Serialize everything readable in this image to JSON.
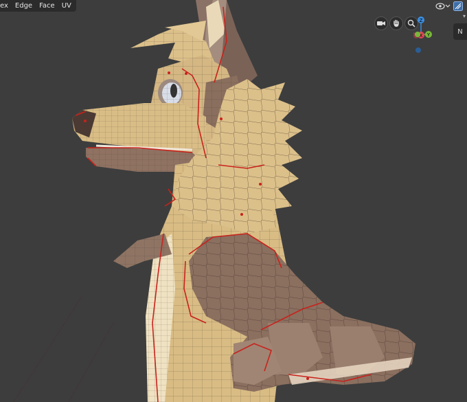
{
  "menu": {
    "items": [
      "ex",
      "Edge",
      "Face",
      "UV"
    ]
  },
  "axes": {
    "z": "Z",
    "x": "X",
    "y": "Y"
  },
  "sidebar": {
    "tab_label": "N",
    "collapse_arrow": "▾"
  },
  "icons": {
    "camera": "camera-icon",
    "hand": "hand-pan-icon",
    "zoom": "zoom-icon",
    "viewport_shading": "eye-icon",
    "overlay": "overlay-icon"
  },
  "colors": {
    "background": "#3d3d3d",
    "fur_light": "#dcc08a",
    "fur_brown": "#8a6f5e",
    "seam": "#c8221c",
    "axis_x": "#e04a5a",
    "axis_y": "#79b83a",
    "axis_z": "#3b8ee0"
  }
}
